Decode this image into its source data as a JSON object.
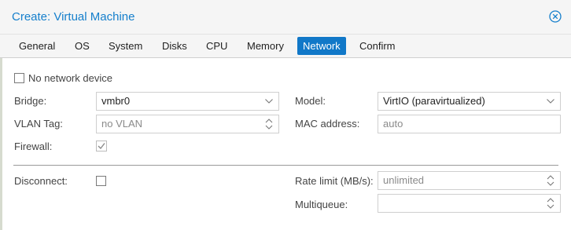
{
  "dialog": {
    "title": "Create: Virtual Machine",
    "close_icon": "close-circle-icon"
  },
  "tabs": [
    "General",
    "OS",
    "System",
    "Disks",
    "CPU",
    "Memory",
    "Network",
    "Confirm"
  ],
  "active_tab": "Network",
  "form": {
    "no_network_label": "No network device",
    "bridge_label": "Bridge:",
    "bridge_value": "vmbr0",
    "vlan_label": "VLAN Tag:",
    "vlan_placeholder": "no VLAN",
    "firewall_label": "Firewall:",
    "firewall_checked": true,
    "model_label": "Model:",
    "model_value": "VirtIO (paravirtualized)",
    "mac_label": "MAC address:",
    "mac_placeholder": "auto",
    "disconnect_label": "Disconnect:",
    "disconnect_checked": false,
    "rate_label": "Rate limit (MB/s):",
    "rate_placeholder": "unlimited",
    "multiqueue_label": "Multiqueue:",
    "multiqueue_value": ""
  },
  "colors": {
    "accent": "#1178c8",
    "title": "#157fcc"
  }
}
